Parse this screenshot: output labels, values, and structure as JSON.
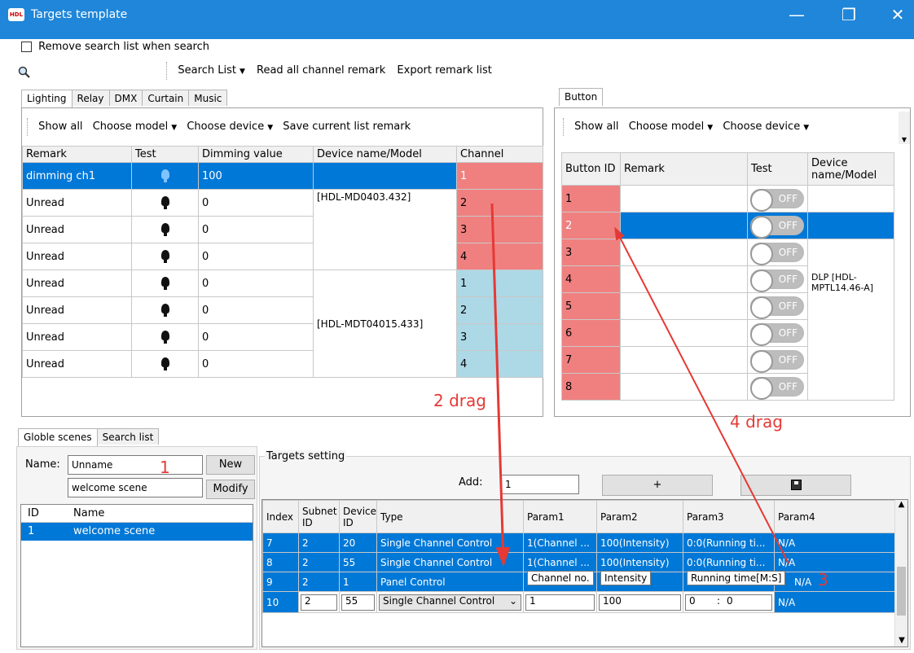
{
  "window": {
    "title": "Targets template",
    "logo_text": "HDL",
    "minimize": "—",
    "maximize": "❐",
    "close": "✕"
  },
  "options": {
    "remove_search_list": "Remove search list when search"
  },
  "top_toolbar": {
    "search_list": "Search List",
    "read_all": "Read all channel remark",
    "export": "Export remark list"
  },
  "left_tabs": [
    "Lighting",
    "Relay",
    "DMX",
    "Curtain",
    "Music"
  ],
  "left_toolbar": {
    "show_all": "Show all",
    "choose_model": "Choose model",
    "choose_device": "Choose device",
    "save_remark": "Save current list remark"
  },
  "lighting_table": {
    "headers": [
      "Remark",
      "Test",
      "Dimming value",
      "Device name/Model",
      "Channel"
    ],
    "rows": [
      {
        "remark": "dimming ch1",
        "value": "100",
        "channel": "1"
      },
      {
        "remark": "Unread",
        "value": "0",
        "channel": "2"
      },
      {
        "remark": "Unread",
        "value": "0",
        "channel": "3"
      },
      {
        "remark": "Unread",
        "value": "0",
        "channel": "4"
      },
      {
        "remark": "Unread",
        "value": "0",
        "channel": "1"
      },
      {
        "remark": "Unread",
        "value": "0",
        "channel": "2"
      },
      {
        "remark": "Unread",
        "value": "0",
        "channel": "3"
      },
      {
        "remark": "Unread",
        "value": "0",
        "channel": "4"
      }
    ],
    "device1": "[HDL-MD0403.432]",
    "device2": "[HDL-MDT04015.433]"
  },
  "right_tabs": [
    "Button"
  ],
  "right_toolbar": {
    "show_all": "Show all",
    "choose_model": "Choose model",
    "choose_device": "Choose device"
  },
  "button_table": {
    "headers": [
      "Button ID",
      "Remark",
      "Test",
      "Device name/Model"
    ],
    "ids": [
      "1",
      "2",
      "3",
      "4",
      "5",
      "6",
      "7",
      "8"
    ],
    "toggle_label": "OFF",
    "device": "DLP [HDL-MPTL14.46-A]"
  },
  "bottom_tabs": [
    "Globle scenes",
    "Search list"
  ],
  "scene_form": {
    "name_label": "Name:",
    "name_value": "Unname",
    "scene_value": "welcome scene",
    "new_btn": "New",
    "modify_btn": "Modify"
  },
  "scene_list": {
    "headers": [
      "ID",
      "Name"
    ],
    "rows": [
      {
        "id": "1",
        "name": "welcome scene"
      }
    ]
  },
  "targets": {
    "group_label": "Targets setting",
    "add_label": "Add:",
    "add_value": "1",
    "plus_btn": "+",
    "save_icon_char": "💾",
    "headers": [
      "Index",
      "Subnet ID",
      "Device ID",
      "Type",
      "Param1",
      "Param2",
      "Param3",
      "Param4"
    ],
    "rows": [
      {
        "index": "7",
        "subnet": "2",
        "device": "20",
        "type": "Single Channel Control",
        "p1": "1(Channel ...",
        "p2": "100(Intensity)",
        "p3": "0:0(Running ti...",
        "p4": "N/A"
      },
      {
        "index": "8",
        "subnet": "2",
        "device": "55",
        "type": "Single Channel Control",
        "p1": "1(Channel ...",
        "p2": "100(Intensity)",
        "p3": "0:0(Running ti...",
        "p4": "N/A"
      },
      {
        "index": "9",
        "subnet": "2",
        "device": "1",
        "type": "Panel Control",
        "p1": "",
        "p2": "",
        "p3": "",
        "p4": "N/A"
      },
      {
        "index": "10",
        "subnet": "2",
        "device": "55",
        "type": "Single Channel Control",
        "p1": "1",
        "p2": "100",
        "p3_min": "0",
        "p3_sep": ":",
        "p3_sec": "0",
        "p4": "N/A"
      }
    ],
    "tooltips": {
      "p1": "Channel no.",
      "p2": "Intensity",
      "p3": "Running time[M:S]"
    }
  },
  "annotations": {
    "label1": "1",
    "label2": "2 drag",
    "label3": "3",
    "label4": "4 drag",
    "color": "#e53935"
  }
}
